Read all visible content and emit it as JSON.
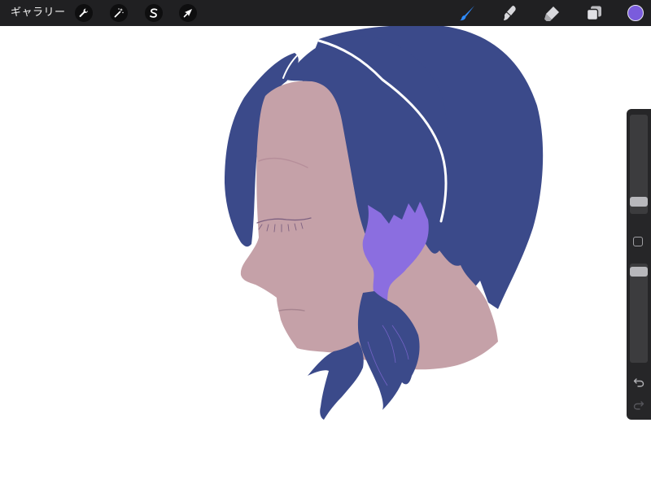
{
  "toolbar": {
    "gallery_label": "ギャラリー",
    "left_tools": [
      {
        "name": "actions",
        "icon": "wrench-icon"
      },
      {
        "name": "adjustments",
        "icon": "magic-wand-icon"
      },
      {
        "name": "selection",
        "icon": "selection-s-icon"
      },
      {
        "name": "transform",
        "icon": "arrow-cursor-icon"
      }
    ],
    "right_tools": [
      {
        "name": "brush",
        "icon": "brush-icon",
        "active": true
      },
      {
        "name": "smudge",
        "icon": "smudge-icon",
        "active": false
      },
      {
        "name": "eraser",
        "icon": "eraser-icon",
        "active": false
      },
      {
        "name": "layers",
        "icon": "layers-icon",
        "active": false
      }
    ],
    "current_color": "#7a5cdc",
    "active_tool_color": "#2f8cff"
  },
  "sidebar": {
    "brush_size_level": 0.24,
    "brush_opacity_level": 0.96,
    "undo_icon": "undo-arrow-icon",
    "redo_icon": "redo-arrow-icon",
    "modify_icon": "square-modify-icon"
  },
  "colors": {
    "hair": "#3b4a8a",
    "skin": "#c5a1a8",
    "highlight_purple": "#8b6ee0",
    "toolbar_bg": "#202022"
  }
}
